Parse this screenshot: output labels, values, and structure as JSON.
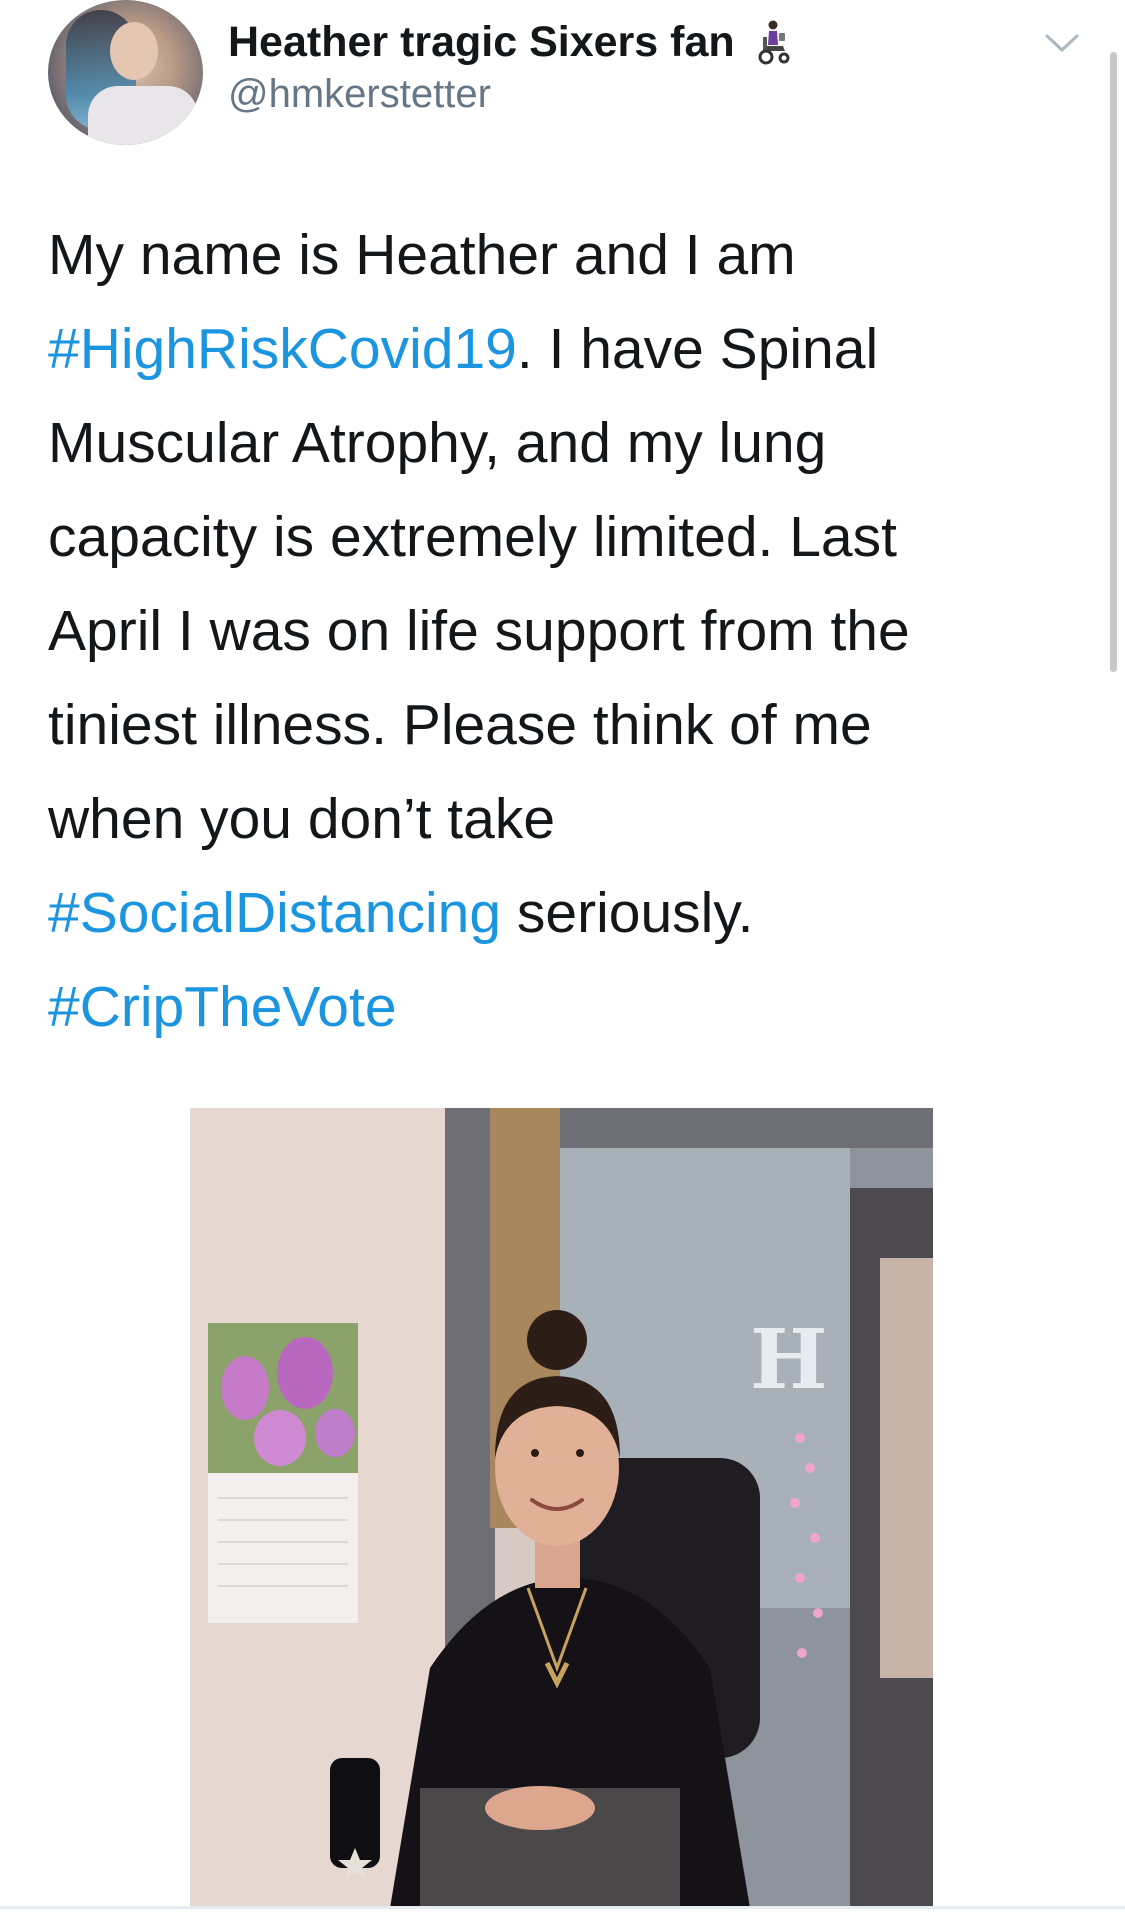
{
  "tweet": {
    "author": {
      "display_name": "Heather tragic Sixers fan",
      "name_emoji": "person-in-motorized-wheelchair-icon",
      "handle": "@hmkerstetter"
    },
    "text_lines": [
      [
        {
          "text": "My name is Heather and I am",
          "type": "text"
        }
      ],
      [
        {
          "text": "#HighRiskCovid19",
          "type": "hashtag"
        },
        {
          "text": ". I have Spinal",
          "type": "text"
        }
      ],
      [
        {
          "text": "Muscular Atrophy, and my lung",
          "type": "text"
        }
      ],
      [
        {
          "text": "capacity is extremely limited. Last",
          "type": "text"
        }
      ],
      [
        {
          "text": "April I was on life support from the",
          "type": "text"
        }
      ],
      [
        {
          "text": "tiniest illness. Please think of me",
          "type": "text"
        }
      ],
      [
        {
          "text": "when you don’t take",
          "type": "text"
        }
      ],
      [
        {
          "text": "#SocialDistancing",
          "type": "hashtag"
        },
        {
          "text": " seriously.",
          "type": "text"
        }
      ],
      [
        {
          "text": "#CripTheVote",
          "type": "hashtag"
        }
      ]
    ],
    "photo": {
      "letter_sign": "H"
    }
  },
  "icons": {
    "more_menu": "chevron-down-icon"
  },
  "colors": {
    "text": "#14171a",
    "secondary_text": "#657786",
    "hashtag": "#1b95e0",
    "background": "#ffffff"
  }
}
